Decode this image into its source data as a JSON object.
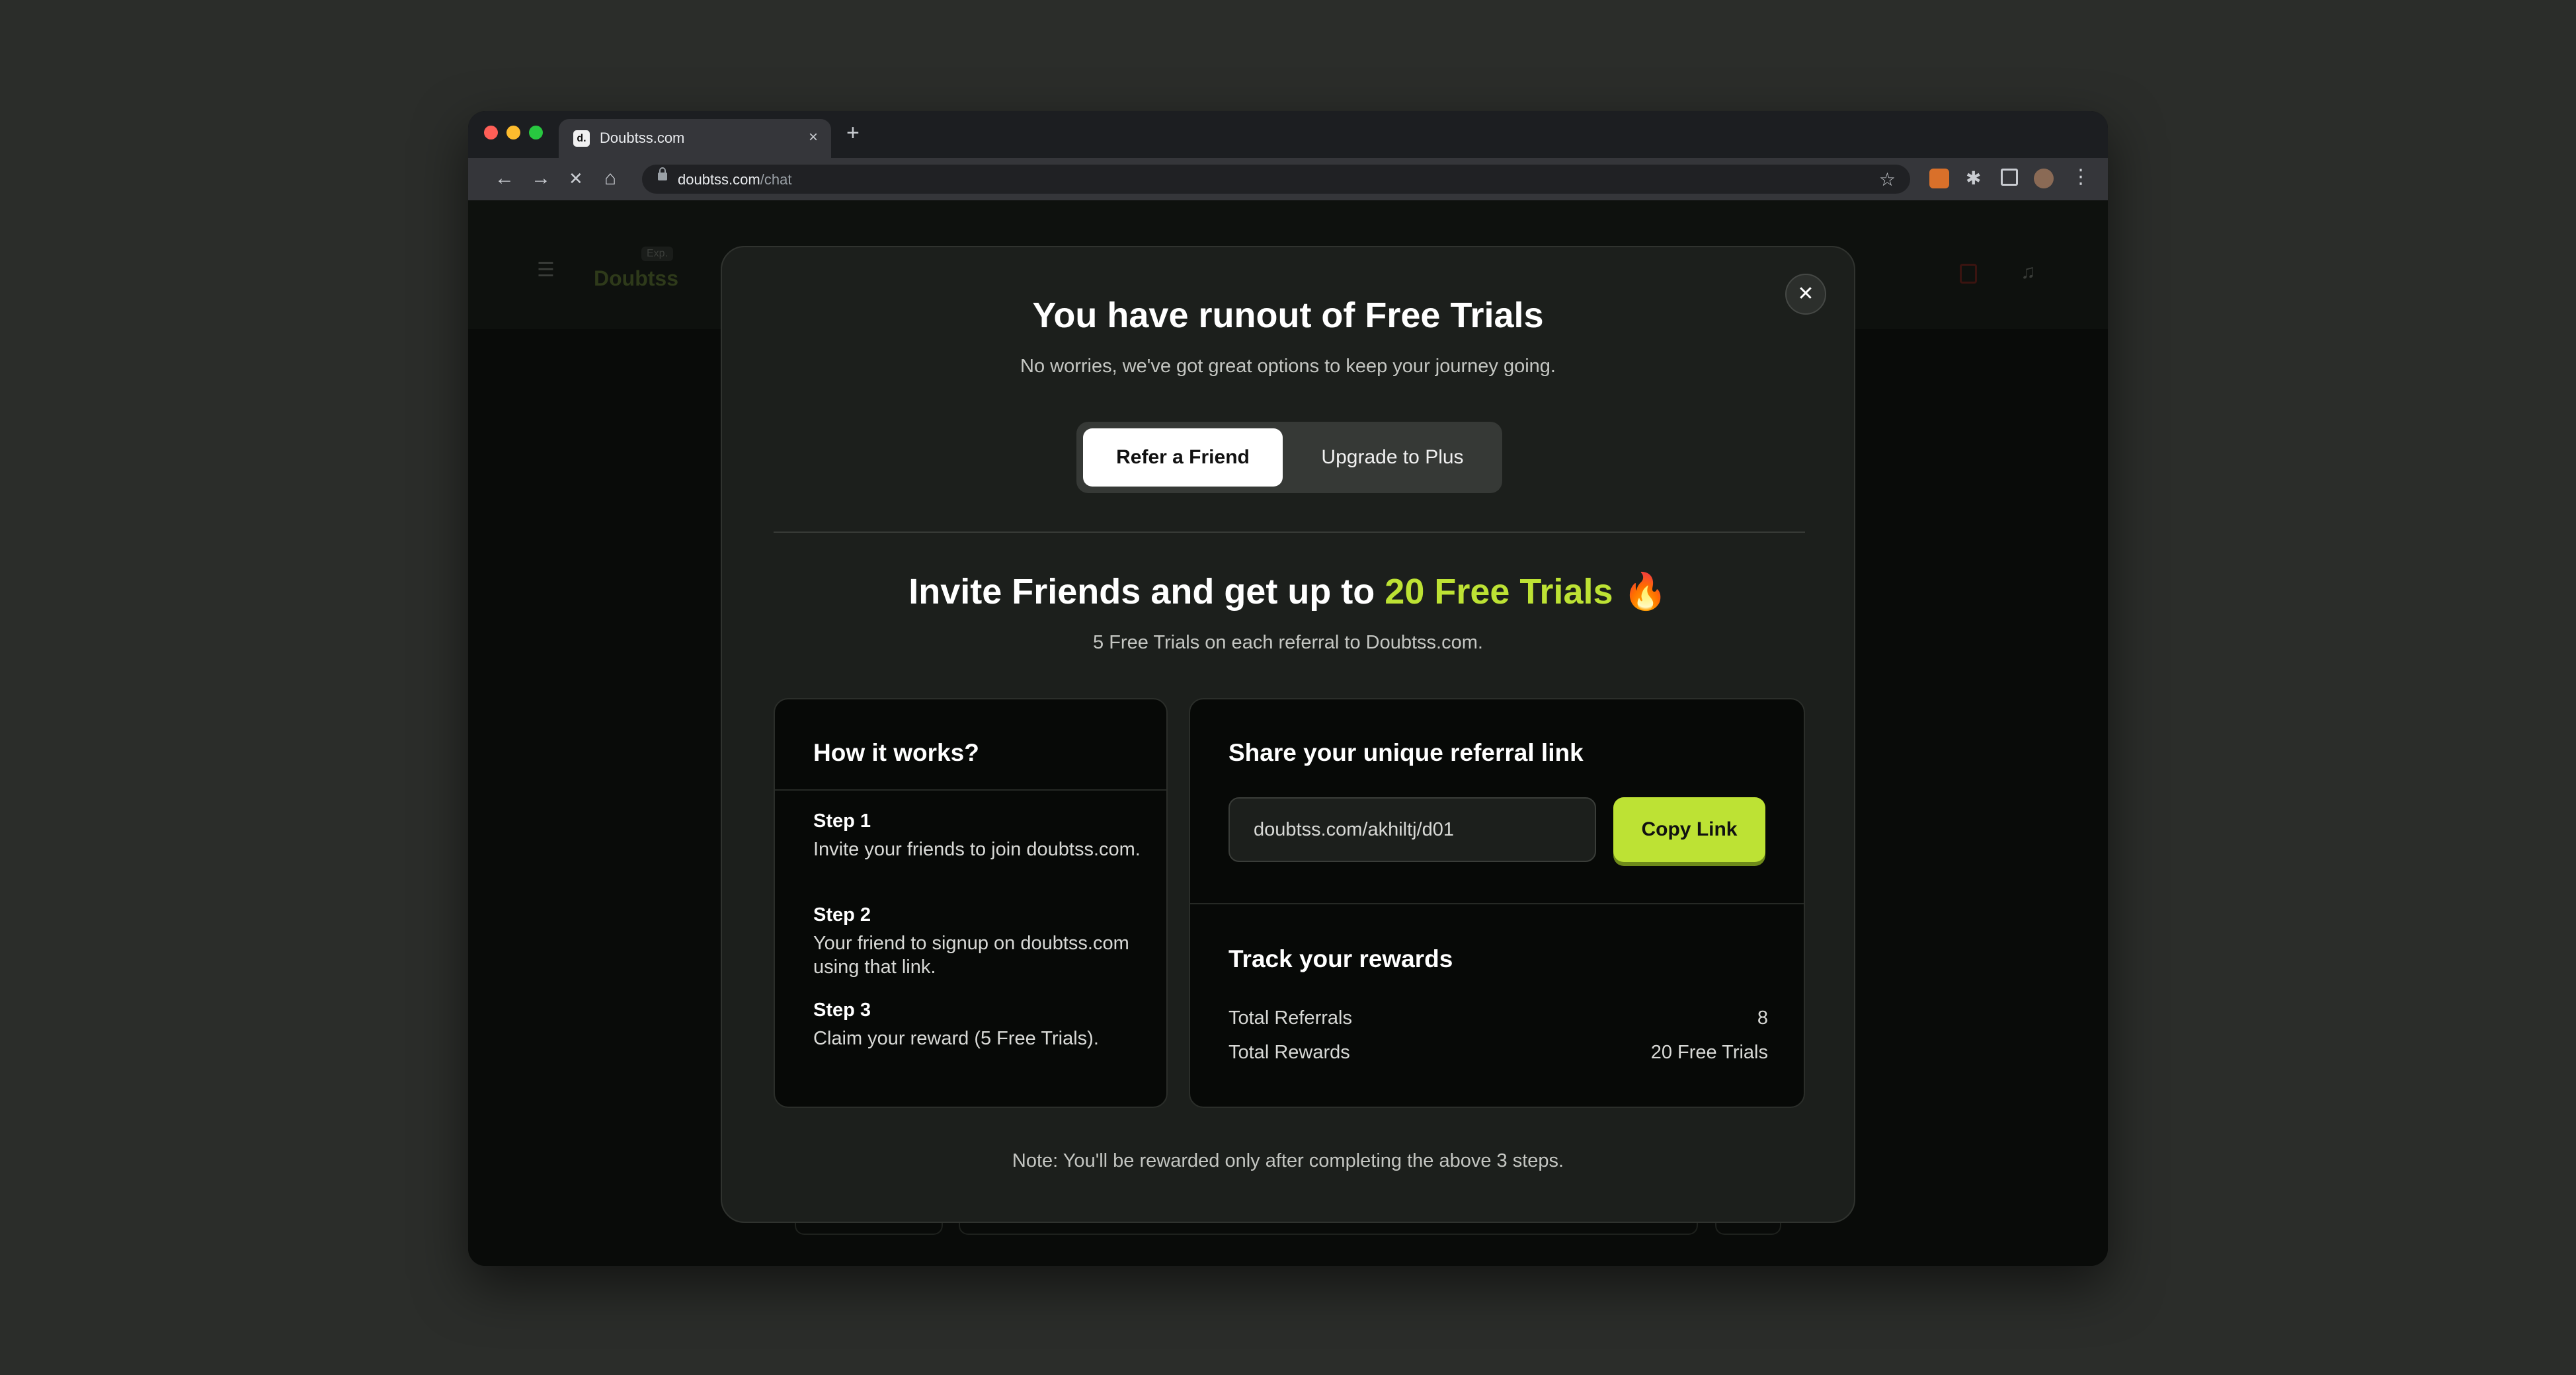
{
  "browser": {
    "tab": {
      "favicon": "d.",
      "title": "Doubtss.com",
      "close": "×"
    },
    "new_tab": "+",
    "nav": {
      "back": "←",
      "forward": "→",
      "stop": "✕",
      "home": "⌂"
    },
    "url": {
      "host": "doubtss.com",
      "path": "/chat"
    },
    "icons": [
      "lock-icon",
      "star-icon",
      "extension-icon",
      "puzzle-icon",
      "sidebar-icon",
      "profile-avatar",
      "menu-icon"
    ]
  },
  "app": {
    "logo": "Doubtss",
    "beta": "Exp.",
    "menu_glyph": "☰",
    "bell_glyph": "🔔"
  },
  "modal": {
    "close": "✕",
    "title": "You have runout of Free Trials",
    "subtitle": "No worries, we've got great options to keep your journey going.",
    "tabs": [
      {
        "label": "Refer a Friend",
        "active": true
      },
      {
        "label": "Upgrade to Plus",
        "active": false
      }
    ],
    "invite": {
      "title_prefix": "Invite Friends and get up to ",
      "title_accent": "20 Free Trials",
      "title_emoji": " 🔥",
      "subtitle": "5 Free Trials on each referral to Doubtss.com."
    },
    "how_it_works": {
      "title": "How it works?",
      "steps": [
        {
          "label": "Step 1",
          "text": "Invite your friends to join doubtss.com."
        },
        {
          "label": "Step 2",
          "text": "Your friend to signup on doubtss.com using that link."
        },
        {
          "label": "Step 3",
          "text": "Claim your reward (5 Free Trials)."
        }
      ]
    },
    "share": {
      "title": "Share your unique referral link",
      "link": "doubtss.com/akhiltj/d01",
      "copy_label": "Copy Link"
    },
    "rewards": {
      "title": "Track your rewards",
      "rows": [
        {
          "label": "Total Referrals",
          "value": "8"
        },
        {
          "label": "Total Rewards",
          "value": "20 Free Trials"
        }
      ]
    },
    "note": "Note: You'll be rewarded only after completing the above 3 steps."
  },
  "colors": {
    "accent": "#bde234",
    "modal_bg": "#1c1f1c",
    "card_bg": "#070907"
  }
}
